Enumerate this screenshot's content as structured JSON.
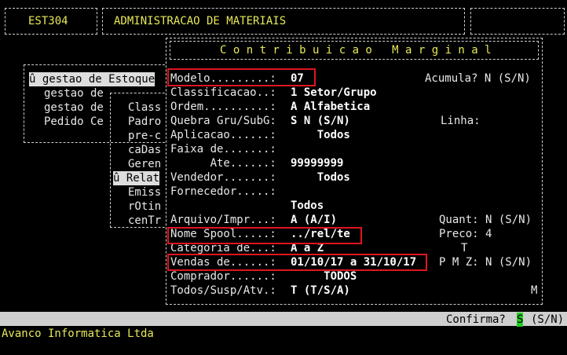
{
  "header": {
    "code": "EST304",
    "title": "ADMINISTRACAO DE MATERIAIS"
  },
  "menu": {
    "items": [
      "û gestao de Estoque",
      "gestao de",
      "gestao de",
      "Pedido Ce"
    ],
    "sub": [
      "Class",
      "Padro",
      "pre-c",
      "caDas",
      "Geren",
      "û Relat",
      "Emiss",
      "rOtin",
      "cenTr"
    ]
  },
  "dialog": {
    "title": "C o n t r i b u i c a o   M a r g i n a l",
    "rows": [
      {
        "label": "Modelo.........:",
        "value": "07",
        "extra": "Acumula? N (S/N)"
      },
      {
        "label": "Classificacao..:",
        "value": "1 Setor/Grupo"
      },
      {
        "label": "Ordem..........:",
        "value": "A Alfabetica"
      },
      {
        "label": "Quebra Gru/SubG:",
        "value": "S N (S/N)",
        "extra": "Linha:"
      },
      {
        "label": "Aplicacao......:",
        "value": "    Todos"
      },
      {
        "label": "Faixa de.......:",
        "value": ""
      },
      {
        "label": "      Ate......:",
        "value": "99999999"
      },
      {
        "label": "Vendedor.......:",
        "value": "    Todos"
      },
      {
        "label": "Fornecedor.....:",
        "value": ""
      },
      {
        "label": "",
        "value": "Todos"
      },
      {
        "label": "Arquivo/Impr...:",
        "value": "A (A/I)",
        "extra": "Quant: N (S/N)"
      },
      {
        "label": "Nome Spool.....:",
        "value": "../rel/te",
        "extra": "Preco: 4"
      },
      {
        "label": "Categoria de...:",
        "value": "A a Z",
        "extra": "T"
      },
      {
        "label": "Vendas de......:",
        "value": "01/10/17 a 31/10/17",
        "extra": "P M Z: N (S/N)"
      },
      {
        "label": "Comprador......:",
        "value": "     TODOS"
      },
      {
        "label": "Todos/Susp/Atv.:",
        "value": "T (T/S/A)",
        "extra": "M"
      }
    ]
  },
  "status": {
    "prompt": "Confirma?",
    "answer": "S",
    "hint": "(S/N)"
  },
  "footer": {
    "company": "Avanco Informatica Ltda"
  }
}
